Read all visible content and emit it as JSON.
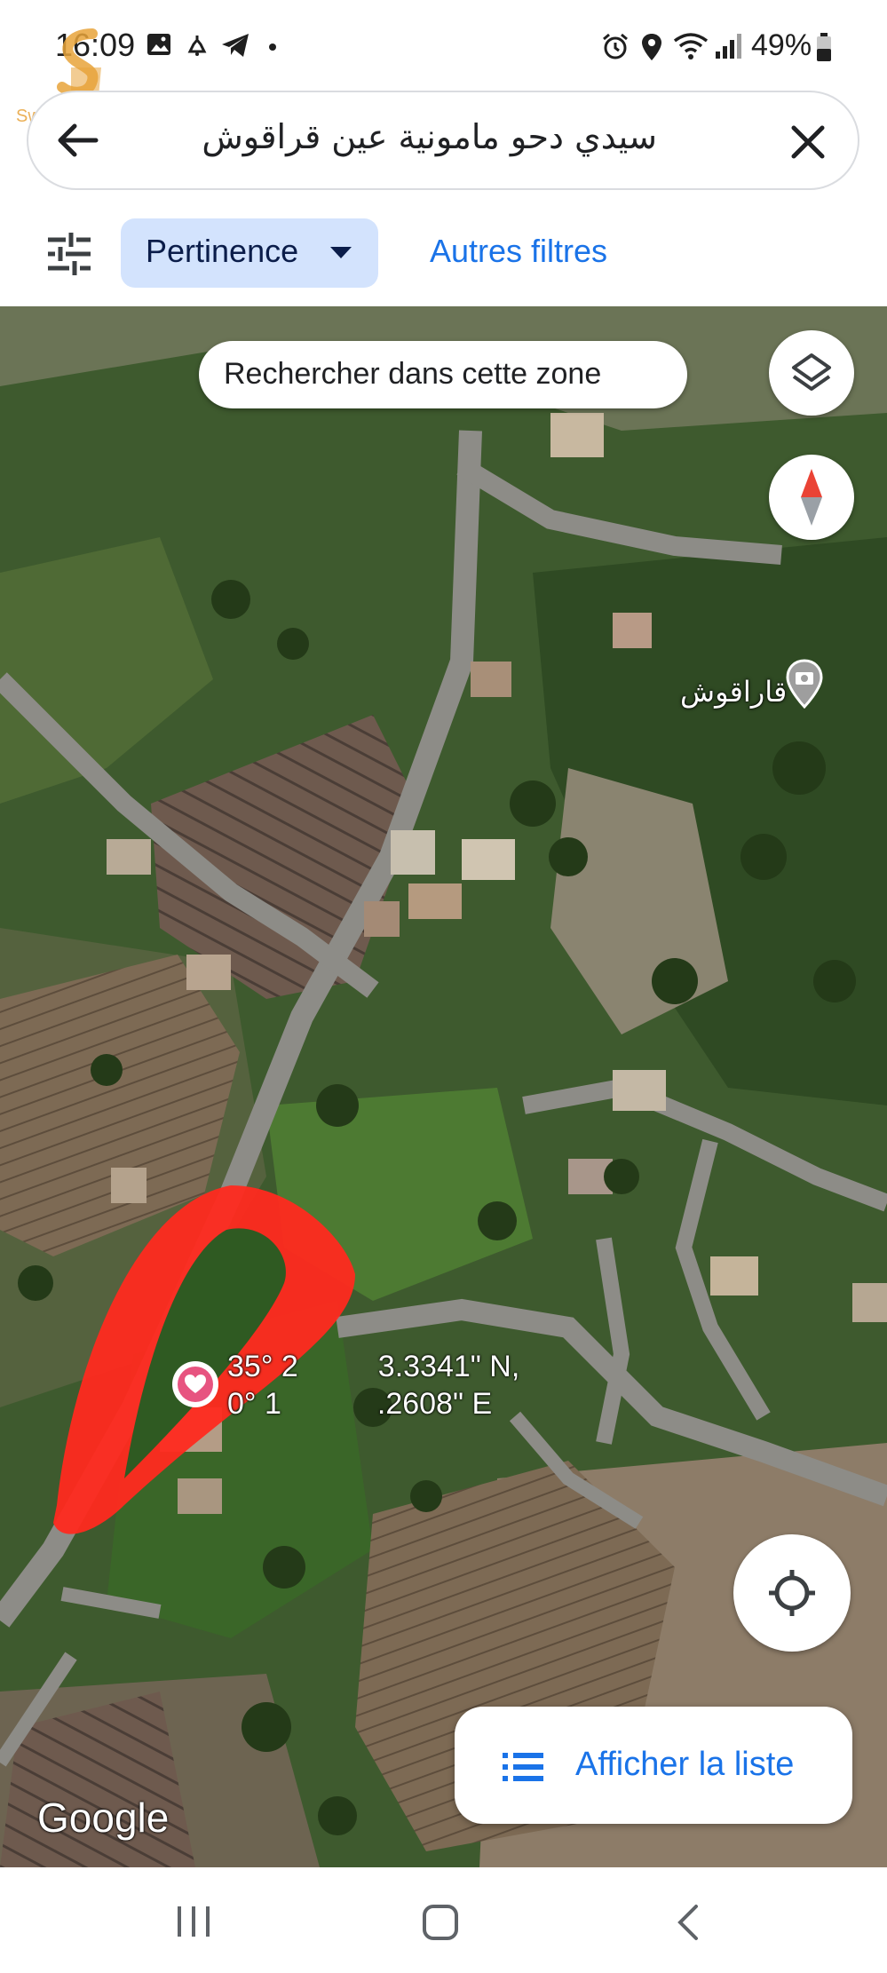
{
  "status_bar": {
    "time": "16:09",
    "battery": "49%",
    "left_icons": [
      "image-icon",
      "alarm-bell-icon",
      "telegram-icon",
      "dot-icon"
    ],
    "right_icons": [
      "alarm-clock-icon",
      "location-icon",
      "wifi-icon",
      "signal-icon",
      "battery-icon"
    ]
  },
  "watermark": {
    "text": "Swiga | سويقة",
    "color": "#e8a33a"
  },
  "search": {
    "query": "سيدي دحو مامونية عين قراقوش",
    "back_icon": "arrow-left-icon",
    "clear_icon": "close-icon"
  },
  "filters": {
    "filter_icon": "tune-icon",
    "sort_label": "Pertinence",
    "other_filters_label": "Autres filtres",
    "accent": "#1a73e8",
    "chip_bg": "#d3e3fd"
  },
  "map": {
    "search_area_label": "Rechercher dans cette zone",
    "layers_icon": "layers-icon",
    "compass_icon": "compass-icon",
    "place_label": "قاراقوش",
    "place_icon": "camera-pin-icon",
    "marker_icon": "heart-pin-icon",
    "coordinates_line1": "35° 2",
    "coordinates_line1_end": "3.3341\" N,",
    "coordinates_line2": "0° 1",
    "coordinates_line2_end": ".2608\" E",
    "annotation_color": "#ff2a1f",
    "google_label": "Google",
    "locate_icon": "my-location-icon"
  },
  "list_button": {
    "label": "Afficher la liste",
    "icon": "list-icon"
  },
  "nav_bar": {
    "recent_icon": "recent-apps-icon",
    "home_icon": "home-icon",
    "back_icon": "back-chevron-icon"
  }
}
